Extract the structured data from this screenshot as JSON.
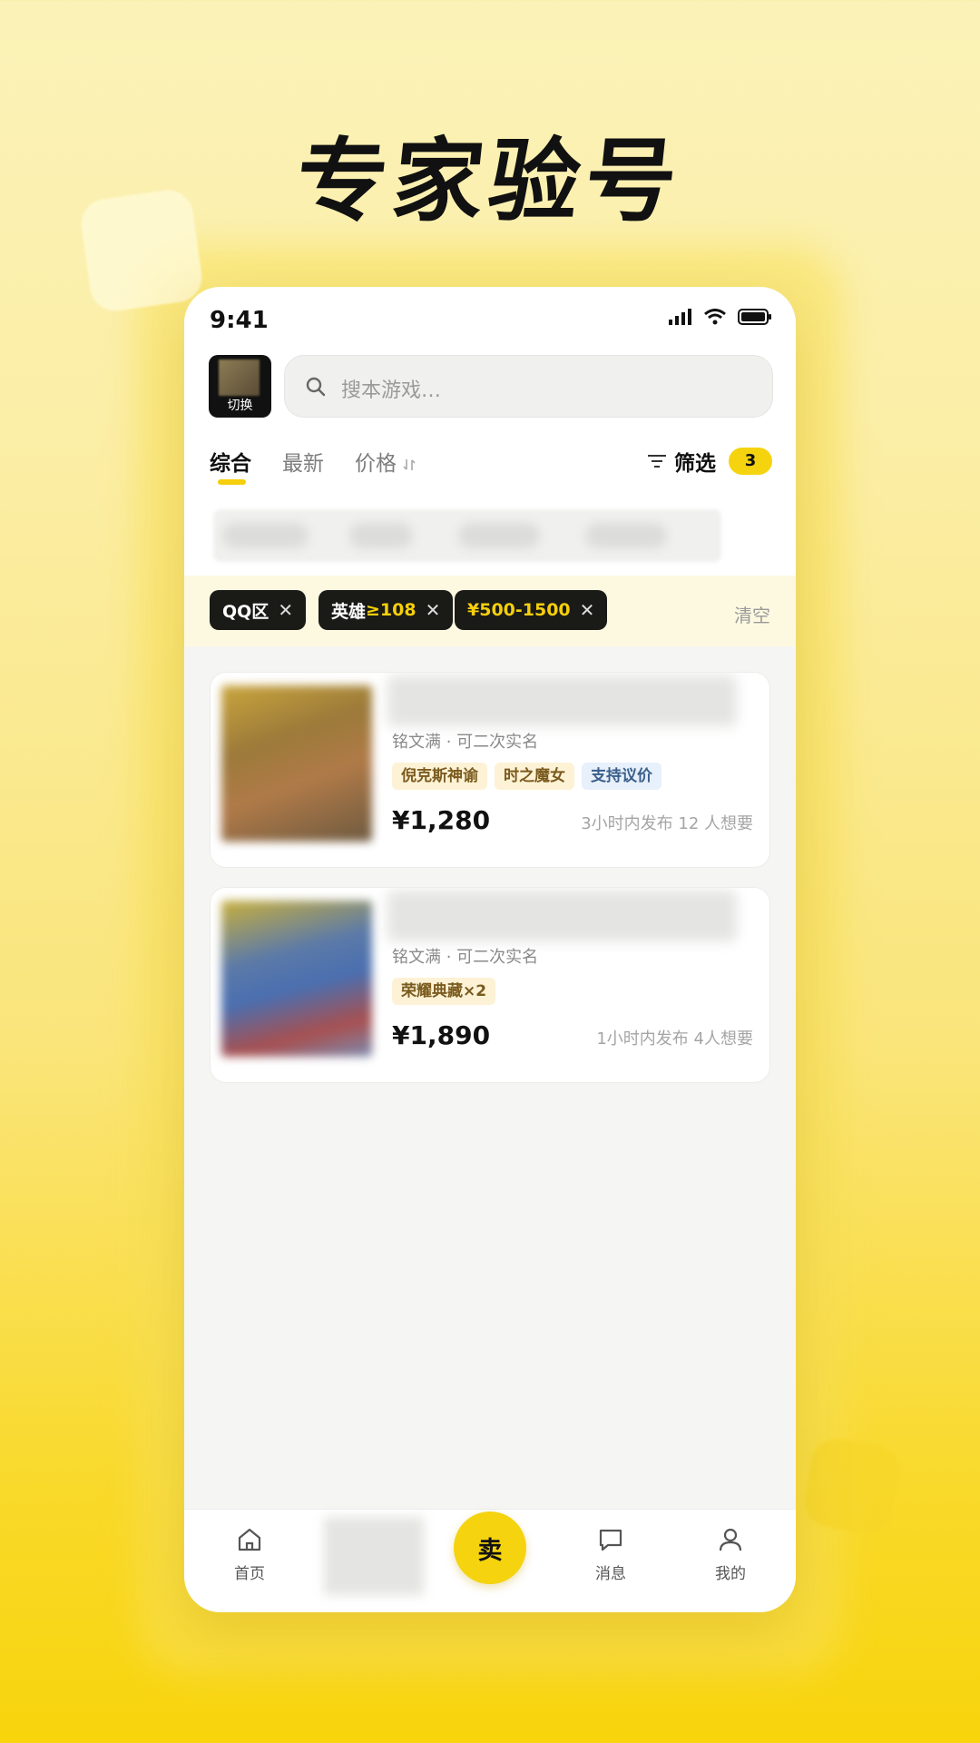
{
  "headline": "专家验号",
  "status_bar": {
    "time": "9:41"
  },
  "header": {
    "switch_label": "切换",
    "search_placeholder": "搜本游戏…"
  },
  "tabs": [
    {
      "label": "综合",
      "active": true
    },
    {
      "label": "最新",
      "active": false
    },
    {
      "label": "价格",
      "active": false
    }
  ],
  "filter": {
    "label": "筛选",
    "count": "3"
  },
  "active_filters": {
    "chips": [
      {
        "text": "QQ区",
        "highlight": ""
      },
      {
        "text": "英雄",
        "highlight": "≥108"
      },
      {
        "text": "",
        "highlight": "¥500-1500"
      }
    ],
    "clear_label": "清空"
  },
  "listings": [
    {
      "subtitle": "铭文满 · 可二次实名",
      "tags": [
        {
          "text": "倪克斯神谕",
          "style": "yellow"
        },
        {
          "text": "时之魔女",
          "style": "yellow"
        },
        {
          "text": "支持议价",
          "style": "blue"
        }
      ],
      "price": "¥1,280",
      "meta": "3小时内发布 12 人想要"
    },
    {
      "subtitle": "铭文满 · 可二次实名",
      "tags": [
        {
          "text": "荣耀典藏×2",
          "style": "yellow"
        }
      ],
      "price": "¥1,890",
      "meta": "1小时内发布 4人想要"
    }
  ],
  "tab_bar": {
    "home": "首页",
    "sell": "卖",
    "messages": "消息",
    "mine": "我的"
  },
  "colors": {
    "accent": "#f5d30f",
    "chip_bg": "#1a1a17"
  }
}
